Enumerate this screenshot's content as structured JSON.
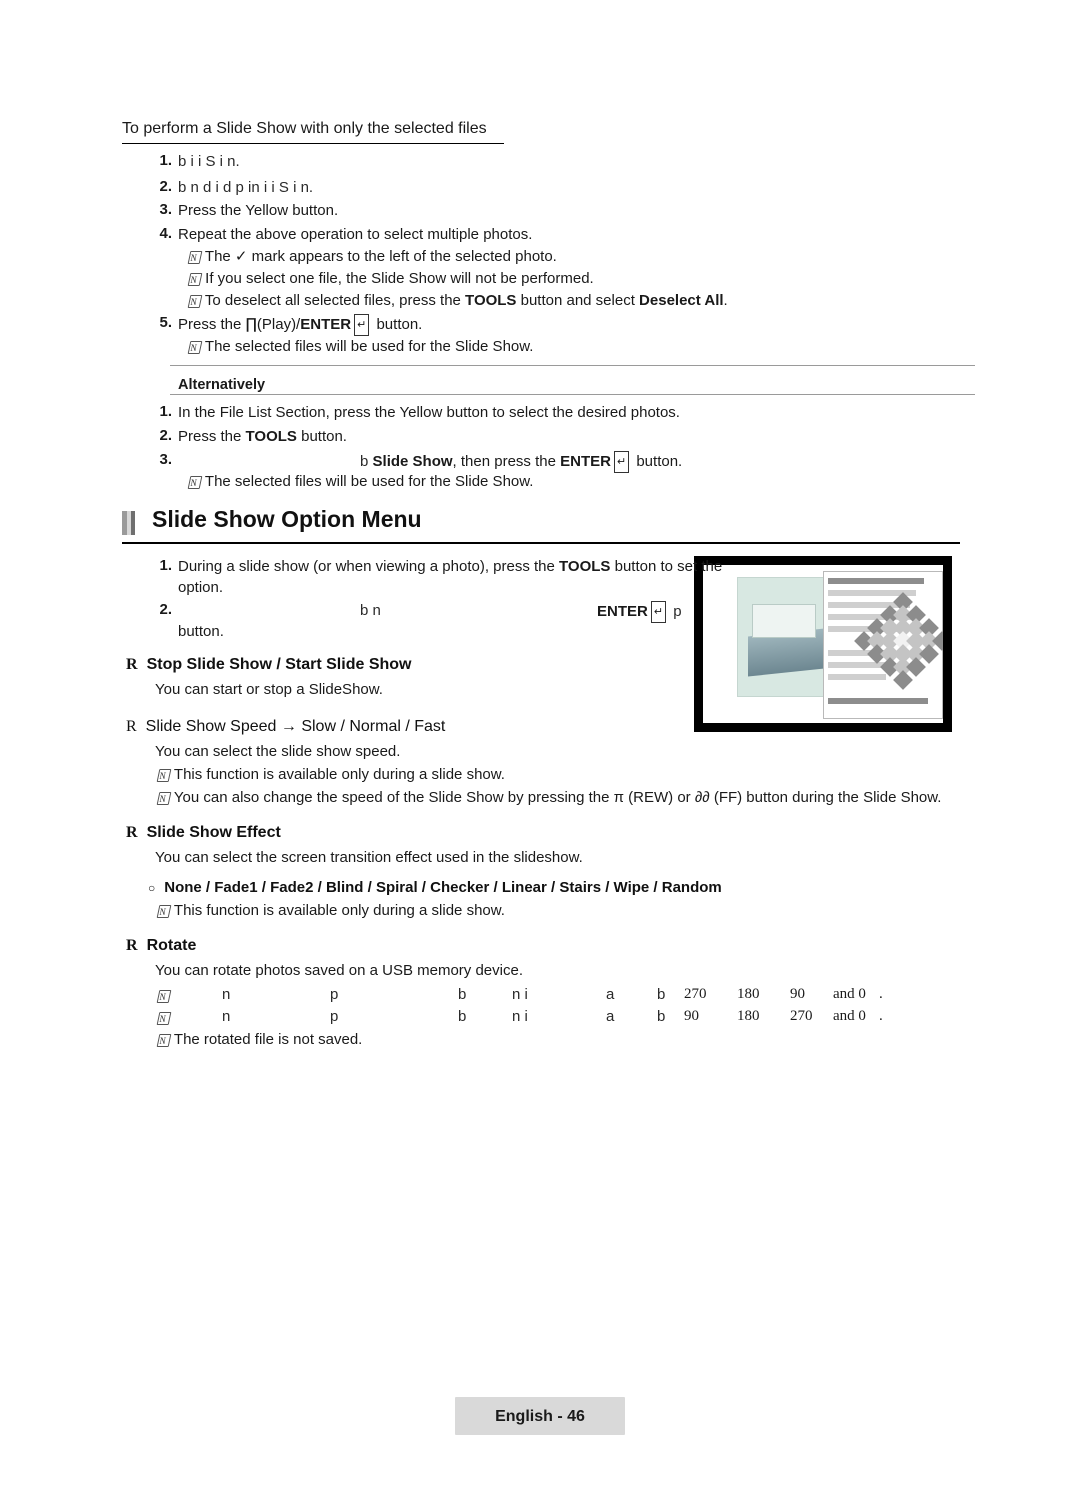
{
  "section1": {
    "title": "To perform a Slide Show with only the selected files",
    "steps": [
      {
        "num": "1.",
        "text": "b                                                 i        i     S        i n."
      },
      {
        "num": "2.",
        "text": "b       n                                   d   i    d p         in           i     i    S       i n."
      },
      {
        "num": "3.",
        "text": "Press the Yellow button."
      },
      {
        "num": "4.",
        "text": "Repeat the above operation to select multiple photos."
      }
    ],
    "notes4": [
      "The  ✓  mark appears to the left of the selected photo.",
      "If you select one file, the Slide Show will not be performed."
    ],
    "note4_deselect_pre": "To deselect all selected files, press the ",
    "note4_deselect_tools": "TOOLS",
    "note4_deselect_mid": " button and select ",
    "note4_deselect_all": "Deselect All",
    "note4_deselect_end": ".",
    "step5": {
      "num": "5.",
      "pre": "Press the  ",
      "play": "∏",
      "mid": "(Play)/",
      "enter": "ENTER",
      "entericon": "↵",
      "end": " button."
    },
    "note5": "The selected files will be used for the Slide Show."
  },
  "alternatively": {
    "label": "Alternatively",
    "steps": [
      {
        "num": "1.",
        "text": "In the File List Section, press the Yellow button to select the desired photos."
      },
      {
        "num": "2.",
        "pre": "Press the ",
        "bold": "TOOLS",
        "post": " button."
      },
      {
        "num": "3.",
        "pre": "b   ",
        "bold1": "Slide Show",
        "mid": ", then press the ",
        "bold2": "ENTER",
        "icon": "↵",
        "post": " button."
      }
    ],
    "note": "The selected files will be used for the Slide Show."
  },
  "heading": "Slide Show Option Menu",
  "menu": {
    "step1": {
      "num": "1.",
      "pre": "During a slide show (or when viewing a photo), press the ",
      "bold": "TOOLS",
      "post": " button to set the",
      "line2": "option."
    },
    "step2": {
      "num": "2.",
      "pre": "b       n",
      "bold": "ENTER",
      "icon": "↵",
      "mid": " p",
      "line2": "button."
    }
  },
  "options": [
    {
      "mark": "R",
      "title": "Stop Slide Show / Start Slide Show",
      "bold": true,
      "body": [
        "You can start or stop a SlideShow."
      ],
      "notes": []
    },
    {
      "mark": "R",
      "title": "Slide Show Speed → Slow / Normal / Fast",
      "bold": false,
      "body": [
        "You can select the slide show speed."
      ],
      "notes": [
        "This function is available only during a slide show.",
        "You can also change the speed of the Slide Show by pressing the  π    (REW) or  ∂∂  (FF) button during the Slide Show."
      ]
    },
    {
      "mark": "R",
      "title": "Slide Show Effect",
      "bold": true,
      "body": [
        "You can select the screen transition effect used in the slideshow."
      ],
      "sub": {
        "mark": "○",
        "title": "None / Fade1 / Fade2 / Blind / Spiral / Checker / Linear / Stairs / Wipe / Random",
        "notes": [
          "This function is available only during a slide show."
        ]
      },
      "notes": []
    },
    {
      "mark": "R",
      "title": "Rotate",
      "bold": true,
      "body": [
        "You can rotate photos saved on a USB memory device."
      ],
      "notes": []
    }
  ],
  "rotate_rows": [
    {
      "cells": [
        "n",
        "p",
        "b",
        "n   i",
        "a",
        "b",
        "270",
        "180",
        "90",
        "and 0",
        "."
      ]
    },
    {
      "cells": [
        "n",
        "p",
        "b",
        "n   i",
        "a",
        "b",
        "90",
        "180",
        "270",
        "and 0",
        "."
      ]
    }
  ],
  "rotate_note": "The rotated file is not saved.",
  "footer": "English - 46",
  "icons": {
    "note": "note-pencil-icon",
    "check": "check-mark-icon",
    "play": "play-icon",
    "rew": "rewind-icon",
    "ff": "fast-forward-icon",
    "enter": "enter-key-icon"
  }
}
